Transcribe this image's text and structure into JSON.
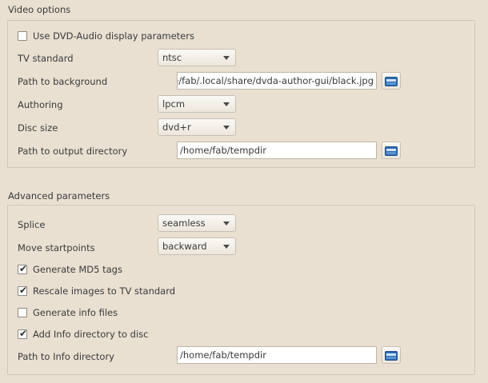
{
  "video_options": {
    "title": "Video options",
    "use_dvd_audio": {
      "label": "Use DVD-Audio display parameters",
      "checked": false
    },
    "tv_standard": {
      "label": "TV standard",
      "value": "ntsc"
    },
    "background": {
      "label": "Path to background",
      "value": "e/fab/.local/share/dvda-author-gui/black.jpg"
    },
    "authoring": {
      "label": "Authoring",
      "value": "lpcm"
    },
    "disc_size": {
      "label": "Disc size",
      "value": "dvd+r"
    },
    "output_dir": {
      "label": "Path to output directory",
      "value": "/home/fab/tempdir"
    }
  },
  "advanced": {
    "title": "Advanced parameters",
    "splice": {
      "label": "Splice",
      "value": "seamless"
    },
    "move_startpoints": {
      "label": "Move startpoints",
      "value": "backward"
    },
    "md5": {
      "label": "Generate MD5 tags",
      "checked": true
    },
    "rescale": {
      "label": "Rescale images to TV standard",
      "checked": true
    },
    "info_files": {
      "label": "Generate info files",
      "checked": false
    },
    "add_info": {
      "label": "Add Info directory to disc",
      "checked": true
    },
    "info_dir": {
      "label": "Path to Info directory",
      "value": "/home/fab/tempdir"
    }
  },
  "check_mark": "✔",
  "icons": {
    "folder_button": "folder-icon",
    "combo_arrow": "chevron-down-icon"
  },
  "colors": {
    "folder_icon": "#2d6db5",
    "background": "#e9e0d2"
  }
}
